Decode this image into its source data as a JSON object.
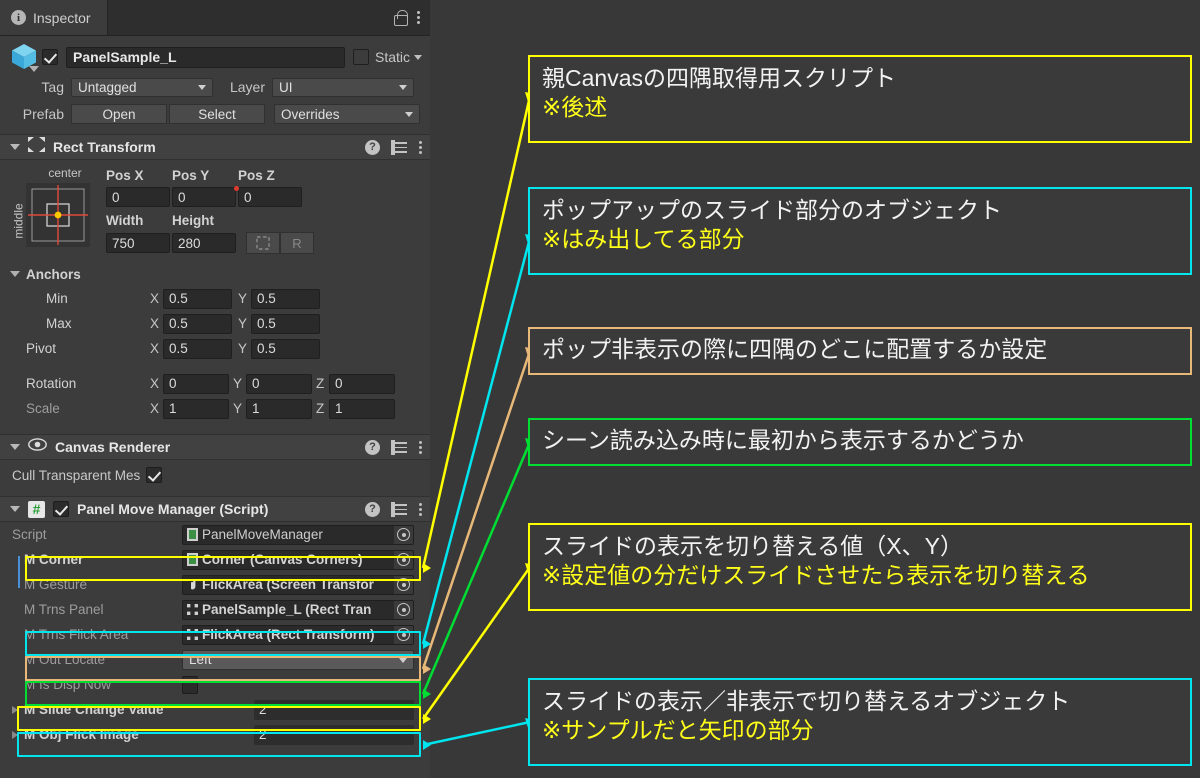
{
  "inspector": {
    "tab_label": "Inspector",
    "lock_icon": "unlocked-padlock-icon",
    "menu_icon": "kebab-menu-icon",
    "gameobject": {
      "icon": "prefab-cube-icon",
      "enabled": true,
      "name": "PanelSample_L",
      "static_label": "Static",
      "tag_label": "Tag",
      "tag_value": "Untagged",
      "layer_label": "Layer",
      "layer_value": "UI",
      "prefab_label": "Prefab",
      "open_label": "Open",
      "select_label": "Select",
      "overrides_label": "Overrides"
    },
    "rect_transform": {
      "title": "Rect Transform",
      "anchor_preset_top": "center",
      "anchor_preset_side": "middle",
      "pos_x_label": "Pos X",
      "pos_y_label": "Pos Y",
      "pos_z_label": "Pos Z",
      "pos_x": "0",
      "pos_y": "0",
      "pos_z": "0",
      "width_label": "Width",
      "height_label": "Height",
      "width": "750",
      "height": "280",
      "blueprint_label": "",
      "raw_label": "R",
      "anchors_label": "Anchors",
      "min_label": "Min",
      "max_label": "Max",
      "pivot_label": "Pivot",
      "rotation_label": "Rotation",
      "scale_label": "Scale",
      "min_x": "0.5",
      "min_y": "0.5",
      "max_x": "0.5",
      "max_y": "0.5",
      "pivot_x": "0.5",
      "pivot_y": "0.5",
      "rot_x": "0",
      "rot_y": "0",
      "rot_z": "0",
      "scale_x": "1",
      "scale_y": "1",
      "scale_z": "1",
      "axis_x": "X",
      "axis_y": "Y",
      "axis_z": "Z"
    },
    "canvas_renderer": {
      "title": "Canvas Renderer",
      "cull_label": "Cull Transparent Mes",
      "cull_checked": true
    },
    "panel_move_manager": {
      "title": "Panel Move Manager (Script)",
      "script_label": "Script",
      "script_value": "PanelMoveManager",
      "fields": [
        {
          "label": "M Corner",
          "value": "Corner (Canvas Corners)",
          "kind": "object",
          "icon": "script-asset-icon",
          "highlight": "yellow"
        },
        {
          "label": "M Gesture",
          "value": "FlickArea (Screen Transfor",
          "kind": "object",
          "icon": "hand-cursor-icon",
          "highlight": "none"
        },
        {
          "label": "M Trns Panel",
          "value": "PanelSample_L (Rect Tran",
          "kind": "object",
          "icon": "rect-transform-icon",
          "highlight": "none"
        },
        {
          "label": "M Trns Flick Area",
          "value": "FlickArea (Rect Transform)",
          "kind": "object",
          "icon": "rect-transform-icon",
          "highlight": "cyan"
        },
        {
          "label": "M Out Locate",
          "value": "Left",
          "kind": "enum",
          "icon": "",
          "highlight": "orange"
        },
        {
          "label": "M Is Disp Now",
          "value": "",
          "kind": "bool",
          "icon": "",
          "highlight": "green",
          "checked": false
        },
        {
          "label": "M Slide Change Value",
          "value": "2",
          "kind": "array",
          "icon": "",
          "highlight": "yellow"
        },
        {
          "label": "M Obj Flick Image",
          "value": "2",
          "kind": "array",
          "icon": "",
          "highlight": "cyan"
        }
      ]
    }
  },
  "annotations": [
    {
      "id": "anno-corner",
      "color": "#ffff00",
      "lines": [
        {
          "text": "親Canvasの四隅取得用スクリプト",
          "style": "white"
        },
        {
          "text": "※後述",
          "style": "yellow"
        }
      ]
    },
    {
      "id": "anno-flick-area",
      "color": "#00e5ee",
      "lines": [
        {
          "text": "ポップアップのスライド部分のオブジェクト",
          "style": "white"
        },
        {
          "text": "※はみ出してる部分",
          "style": "yellow"
        }
      ]
    },
    {
      "id": "anno-out-locate",
      "color": "#e8b878",
      "lines": [
        {
          "text": "ポップ非表示の際に四隅のどこに配置するか設定",
          "style": "white"
        }
      ]
    },
    {
      "id": "anno-is-disp-now",
      "color": "#00dd33",
      "lines": [
        {
          "text": "シーン読み込み時に最初から表示するかどうか",
          "style": "white"
        }
      ]
    },
    {
      "id": "anno-slide-change",
      "color": "#ffff00",
      "lines": [
        {
          "text": "スライドの表示を切り替える値（X、Y）",
          "style": "white"
        },
        {
          "text": "※設定値の分だけスライドさせたら表示を切り替える",
          "style": "yellow"
        }
      ]
    },
    {
      "id": "anno-obj-flick",
      "color": "#00e5ee",
      "lines": [
        {
          "text": "スライドの表示／非表示で切り替えるオブジェクト",
          "style": "white"
        },
        {
          "text": "※サンプルだと矢印の部分",
          "style": "yellow"
        }
      ]
    }
  ],
  "colors": {
    "yellow": "#ffff00",
    "cyan": "#00e5ee",
    "orange": "#e8b878",
    "green": "#00dd33",
    "panel_bg": "#3c3c3c",
    "page_bg": "#383838"
  }
}
